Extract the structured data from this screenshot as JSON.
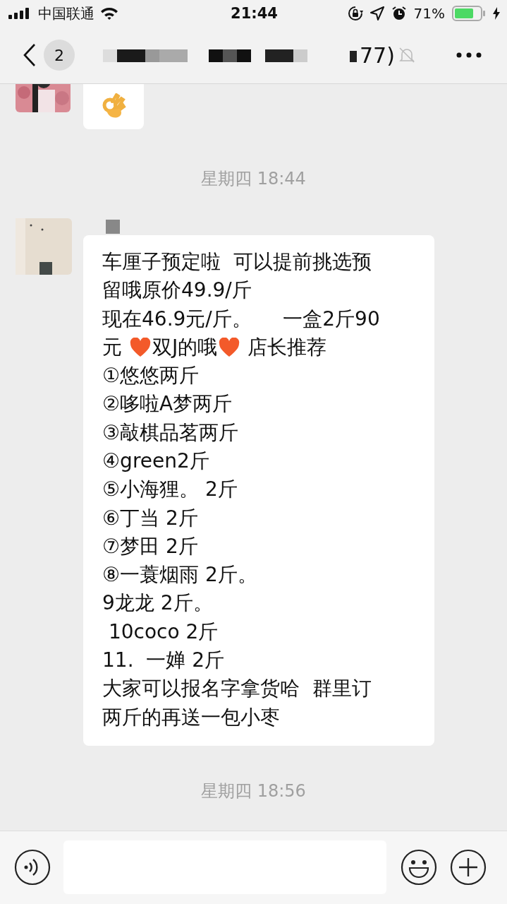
{
  "status_bar": {
    "carrier": "中国联通",
    "time": "21:44",
    "battery": "71%"
  },
  "nav": {
    "back_count": "2",
    "title": "77)"
  },
  "chat": [
    {
      "kind": "emoji_message"
    },
    {
      "kind": "time",
      "text": "星期四 18:44"
    },
    {
      "kind": "text_message",
      "lines": [
        [
          {
            "kind": "text",
            "text": "车厘子预定啦  可以提前挑选预"
          }
        ],
        [
          {
            "kind": "text",
            "text": "留哦原价49.9/斤"
          }
        ],
        [
          {
            "kind": "text",
            "text": "现在46.9元/斤。     一盒2斤90"
          }
        ],
        [
          {
            "kind": "text",
            "text": "元 "
          },
          {
            "kind": "heart"
          },
          {
            "kind": "text",
            "text": "双J的哦"
          },
          {
            "kind": "heart"
          },
          {
            "kind": "text",
            "text": " 店长推荐"
          }
        ],
        [
          {
            "kind": "text",
            "text": "①悠悠两斤"
          }
        ],
        [
          {
            "kind": "text",
            "text": "②哆啦A梦两斤"
          }
        ],
        [
          {
            "kind": "text",
            "text": "③敲棋品茗两斤"
          }
        ],
        [
          {
            "kind": "text",
            "text": "④green2斤"
          }
        ],
        [
          {
            "kind": "text",
            "text": "⑤小海狸。 2斤"
          }
        ],
        [
          {
            "kind": "text",
            "text": "⑥丁当 2斤"
          }
        ],
        [
          {
            "kind": "text",
            "text": "⑦梦田 2斤"
          }
        ],
        [
          {
            "kind": "text",
            "text": "⑧一蓑烟雨 2斤。"
          }
        ],
        [
          {
            "kind": "text",
            "text": "9龙龙 2斤。"
          }
        ],
        [
          {
            "kind": "text",
            "text": " 10coco 2斤"
          }
        ],
        [
          {
            "kind": "text",
            "text": "11.  一婵 2斤"
          }
        ],
        [
          {
            "kind": "text",
            "text": "大家可以报名字拿货哈  群里订"
          }
        ],
        [
          {
            "kind": "text",
            "text": "两斤的再送一包小枣"
          }
        ]
      ]
    },
    {
      "kind": "time",
      "text": "星期四 18:56"
    }
  ]
}
